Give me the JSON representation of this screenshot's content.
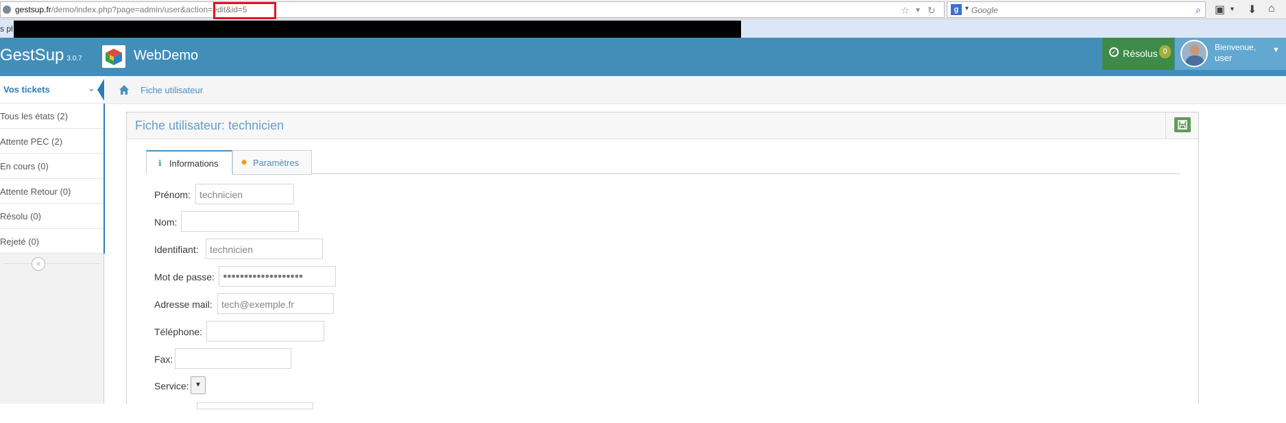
{
  "browser": {
    "url_host": "gestsup.fr",
    "url_path": "/demo/index.php?page=admin/user&action=",
    "url_tail": "edit&id=5",
    "search_engine": "Google",
    "bookmarks_fragment": "s pl"
  },
  "navbar": {
    "brand_name": "GestSup",
    "brand_version": "3.0.7",
    "company": "WebDemo",
    "resolved_label": "Résolus",
    "resolved_count": "0",
    "welcome_label": "Bienvenue,",
    "user_name": "user",
    "colors": {
      "navbar": "#438eb9",
      "resolved": "#3e8b49",
      "user": "#62a8d1"
    }
  },
  "sidebar": {
    "active_label": "Vos tickets",
    "items": [
      {
        "label": "Tous les états (2)"
      },
      {
        "label": "Attente PEC (2)"
      },
      {
        "label": "En cours (0)"
      },
      {
        "label": "Attente Retour (0)"
      },
      {
        "label": "Résolu (0)"
      },
      {
        "label": "Rejeté (0)"
      }
    ]
  },
  "breadcrumb": {
    "label": "Fiche utilisateur"
  },
  "widget": {
    "title": "Fiche utilisateur: technicien",
    "tabs": [
      {
        "label": "Informations",
        "icon": "info-icon"
      },
      {
        "label": "Paramètres",
        "icon": "gear-icon"
      }
    ],
    "form": {
      "prenom_label": "Prénom:",
      "prenom_value": "technicien",
      "nom_label": "Nom:",
      "nom_value": "",
      "identifiant_label": "Identifiant:",
      "identifiant_value": "technicien",
      "password_label": "Mot de passe:",
      "password_value": "●●●●●●●●●●●●●●●●●●●",
      "email_label": "Adresse mail:",
      "email_value": "tech@exemple.fr",
      "phone_label": "Téléphone:",
      "phone_value": "",
      "fax_label": "Fax:",
      "fax_value": "",
      "service_label": "Service:",
      "service_value": ""
    }
  }
}
